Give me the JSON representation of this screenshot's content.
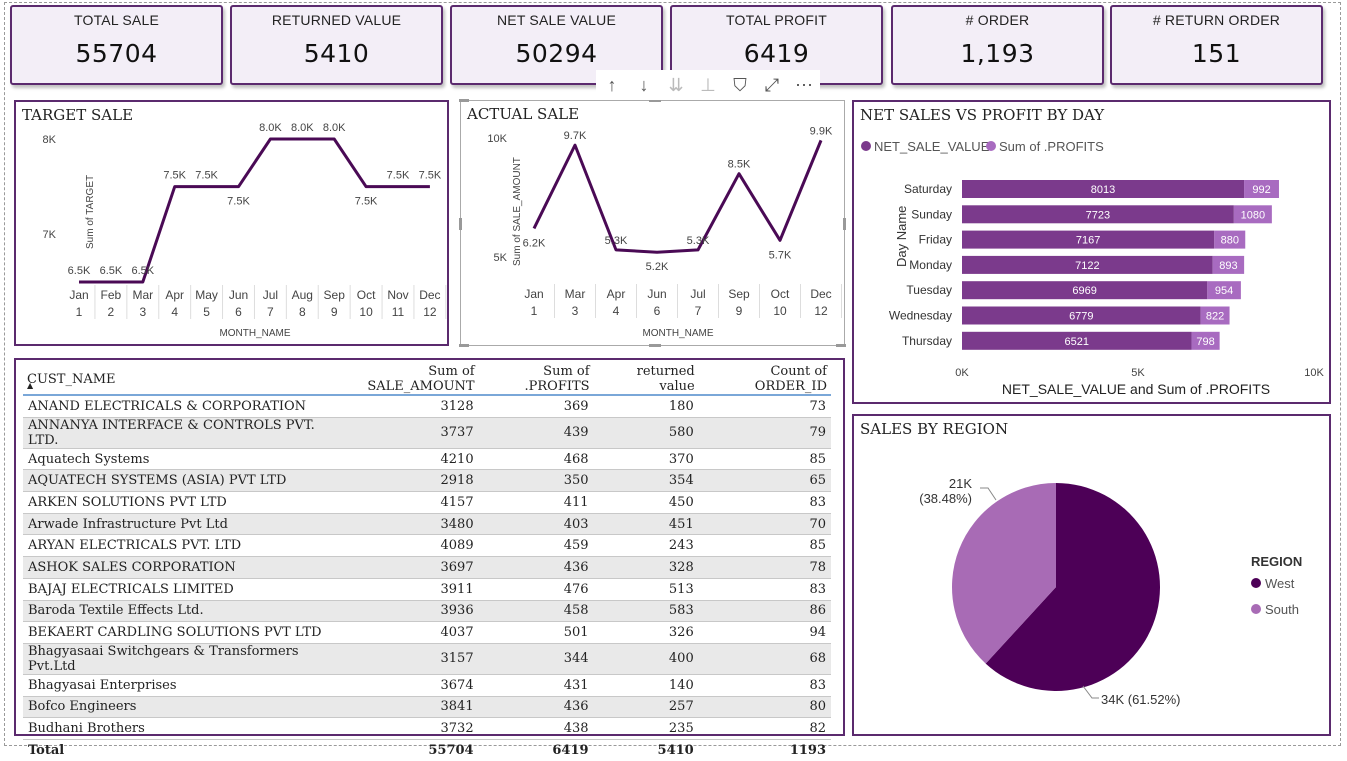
{
  "kpis": [
    {
      "label": "TOTAL SALE",
      "value": "55704"
    },
    {
      "label": "RETURNED VALUE",
      "value": "5410"
    },
    {
      "label": "NET SALE VALUE",
      "value": "50294"
    },
    {
      "label": "TOTAL PROFIT",
      "value": "6419"
    },
    {
      "label": "# ORDER",
      "value": "1,193"
    },
    {
      "label": "# RETURN ORDER",
      "value": "151"
    }
  ],
  "target_sale": {
    "title": "TARGET SALE",
    "ylabel": "Sum of TARGET",
    "xlabel": "MONTH_NAME",
    "y_ticks": [
      "8K",
      "7K"
    ],
    "months": [
      "Jan",
      "Feb",
      "Mar",
      "Apr",
      "May",
      "Jun",
      "Jul",
      "Aug",
      "Sep",
      "Oct",
      "Nov",
      "Dec"
    ],
    "month_nums": [
      "1",
      "2",
      "3",
      "4",
      "5",
      "6",
      "7",
      "8",
      "9",
      "10",
      "11",
      "12"
    ],
    "labels": [
      "6.5K",
      "6.5K",
      "6.5K",
      "7.5K",
      "7.5K",
      "7.5K",
      "8.0K",
      "8.0K",
      "8.0K",
      "7.5K",
      "7.5K",
      "7.5K"
    ]
  },
  "actual_sale": {
    "title": "ACTUAL SALE",
    "ylabel": "Sum of SALE_AMOUNT",
    "xlabel": "MONTH_NAME",
    "y_ticks": [
      "10K",
      "5K"
    ],
    "months": [
      "Jan",
      "Mar",
      "Apr",
      "Jun",
      "Jul",
      "Sep",
      "Oct",
      "Dec"
    ],
    "month_nums": [
      "1",
      "3",
      "4",
      "6",
      "7",
      "9",
      "10",
      "12"
    ],
    "labels": [
      "6.2K",
      "9.7K",
      "5.3K",
      "5.2K",
      "5.3K",
      "8.5K",
      "5.7K",
      "9.9K"
    ]
  },
  "toolbar": {
    "up": "↑",
    "down": "↓",
    "drill_all": "⇊",
    "expand": "⊥",
    "filter": "⛉",
    "focus": "⤢",
    "more": "⋯"
  },
  "net_vs_profit": {
    "title": "NET SALES VS PROFIT BY DAY",
    "legend": [
      "NET_SALE_VALUE",
      "Sum of .PROFITS"
    ],
    "ylabel": "Day Name",
    "xlabel": "NET_SALE_VALUE and Sum of .PROFITS",
    "x_ticks": [
      "0K",
      "5K",
      "10K"
    ],
    "net_label_texts": [
      "8013",
      "7723",
      "7167",
      "7122",
      "6969",
      "6779",
      "6521"
    ],
    "profit_label_texts": [
      "992",
      "1080",
      "880",
      "893",
      "954",
      "822",
      "798"
    ]
  },
  "sales_by_region": {
    "title": "SALES BY REGION",
    "legend_title": "REGION",
    "legend": [
      "West",
      "South"
    ],
    "south_label_line1": "21K",
    "south_label_line2": "(38.48%)",
    "west_label": "34K (61.52%)"
  },
  "table": {
    "headers": [
      "CUST_NAME",
      "Sum of SALE_AMOUNT",
      "Sum of .PROFITS",
      "returned value",
      "Count of ORDER_ID"
    ],
    "rows": [
      [
        "ANAND ELECTRICALS & CORPORATION",
        "3128",
        "369",
        "180",
        "73"
      ],
      [
        "ANNANYA INTERFACE & CONTROLS PVT. LTD.",
        "3737",
        "439",
        "580",
        "79"
      ],
      [
        "Aquatech Systems",
        "4210",
        "468",
        "370",
        "85"
      ],
      [
        "AQUATECH SYSTEMS (ASIA) PVT LTD",
        "2918",
        "350",
        "354",
        "65"
      ],
      [
        "ARKEN SOLUTIONS PVT LTD",
        "4157",
        "411",
        "450",
        "83"
      ],
      [
        "Arwade Infrastructure Pvt Ltd",
        "3480",
        "403",
        "451",
        "70"
      ],
      [
        "ARYAN ELECTRICALS PVT. LTD",
        "4089",
        "459",
        "243",
        "85"
      ],
      [
        "ASHOK SALES CORPORATION",
        "3697",
        "436",
        "328",
        "78"
      ],
      [
        "BAJAJ ELECTRICALS LIMITED",
        "3911",
        "476",
        "513",
        "83"
      ],
      [
        "Baroda Textile Effects Ltd.",
        "3936",
        "458",
        "583",
        "86"
      ],
      [
        "BEKAERT CARDLING SOLUTIONS PVT LTD",
        "4037",
        "501",
        "326",
        "94"
      ],
      [
        "Bhagyasaai Switchgears & Transformers Pvt.Ltd",
        "3157",
        "344",
        "400",
        "68"
      ],
      [
        "Bhagyasai Enterprises",
        "3674",
        "431",
        "140",
        "83"
      ],
      [
        "Bofco Engineers",
        "3841",
        "436",
        "257",
        "80"
      ],
      [
        "Budhani Brothers",
        "3732",
        "438",
        "235",
        "82"
      ]
    ],
    "total": [
      "Total",
      "55704",
      "6419",
      "5410",
      "1193"
    ]
  },
  "colors": {
    "border": "#5b2a6e",
    "line": "#4a0a55",
    "net": "#7b3a8c",
    "profit": "#a86bc0",
    "west": "#4d0057",
    "south": "#a86bb5"
  },
  "chart_data": [
    {
      "type": "line",
      "title": "TARGET SALE",
      "xlabel": "MONTH_NAME",
      "ylabel": "Sum of TARGET",
      "categories": [
        "Jan",
        "Feb",
        "Mar",
        "Apr",
        "May",
        "Jun",
        "Jul",
        "Aug",
        "Sep",
        "Oct",
        "Nov",
        "Dec"
      ],
      "values": [
        6500,
        6500,
        6500,
        7500,
        7500,
        7500,
        8000,
        8000,
        8000,
        7500,
        7500,
        7500
      ],
      "ylim": [
        6500,
        8000
      ]
    },
    {
      "type": "line",
      "title": "ACTUAL SALE",
      "xlabel": "MONTH_NAME",
      "ylabel": "Sum of SALE_AMOUNT",
      "categories": [
        "Jan",
        "Mar",
        "Apr",
        "Jun",
        "Jul",
        "Sep",
        "Oct",
        "Dec"
      ],
      "values": [
        6200,
        9700,
        5300,
        5200,
        5300,
        8500,
        5700,
        9900
      ],
      "ylim": [
        5000,
        10000
      ]
    },
    {
      "type": "bar",
      "title": "NET SALES VS PROFIT BY DAY",
      "xlabel": "NET_SALE_VALUE and Sum of .PROFITS",
      "ylabel": "Day Name",
      "categories": [
        "Saturday",
        "Sunday",
        "Friday",
        "Monday",
        "Tuesday",
        "Wednesday",
        "Thursday"
      ],
      "series": [
        {
          "name": "NET_SALE_VALUE",
          "values": [
            8013,
            7723,
            7167,
            7122,
            6969,
            6779,
            6521
          ]
        },
        {
          "name": "Sum of .PROFITS",
          "values": [
            992,
            1080,
            880,
            893,
            954,
            822,
            798
          ]
        }
      ],
      "xlim": [
        0,
        10000
      ],
      "legend": "top-left"
    },
    {
      "type": "pie",
      "title": "SALES BY REGION",
      "categories": [
        "West",
        "South"
      ],
      "values": [
        34000,
        21000
      ],
      "percents": [
        61.52,
        38.48
      ],
      "legend": "right"
    }
  ]
}
